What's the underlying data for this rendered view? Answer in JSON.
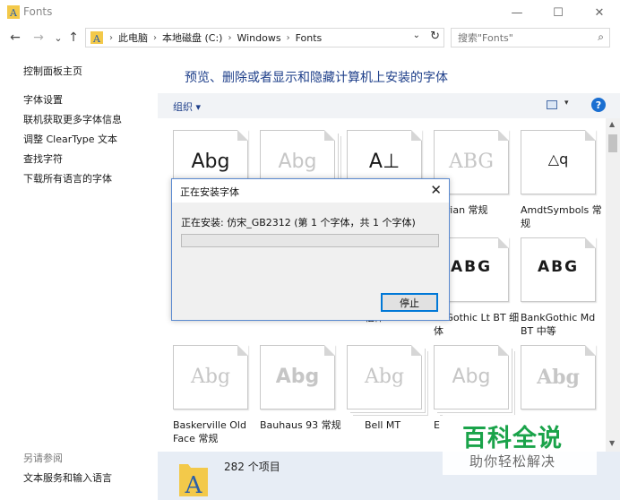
{
  "window": {
    "title": "Fonts",
    "controls": {
      "minimize": "—",
      "maximize": "☐",
      "close": "✕"
    }
  },
  "nav": {
    "back": "←",
    "forward": "→",
    "recent": "⌄",
    "up": "↑",
    "breadcrumb": [
      "此电脑",
      "本地磁盘 (C:)",
      "Windows",
      "Fonts"
    ],
    "separator": "›",
    "dropdown": "⌄",
    "refresh": "↻",
    "search_placeholder": "搜索\"Fonts\"",
    "search_icon": "⌕"
  },
  "sidebar": {
    "items": [
      {
        "label": "控制面板主页"
      },
      {
        "label": "字体设置"
      },
      {
        "label": "联机获取更多字体信息"
      },
      {
        "label": "调整 ClearType 文本"
      },
      {
        "label": "查找字符"
      },
      {
        "label": "下载所有语言的字体"
      }
    ],
    "see_also_title": "另请参阅",
    "see_also_items": [
      {
        "label": "文本服务和输入语言"
      }
    ]
  },
  "main": {
    "heading": "预览、删除或者显示和隐藏计算机上安装的字体",
    "toolbar": {
      "organize": "组织 ▾",
      "view_dropdown": "▾",
      "help": "?"
    },
    "fonts": [
      {
        "preview": "Abg",
        "label": "",
        "style": "dark",
        "stack": false
      },
      {
        "preview": "Abg",
        "label": "",
        "style": "faded",
        "stack": true
      },
      {
        "preview": "A⊥",
        "label": "",
        "style": "dark",
        "stack": false
      },
      {
        "preview": "ABG",
        "label": "gerian 常规",
        "style": "faded",
        "stack": false
      },
      {
        "preview": "△q",
        "label": "AmdtSymbols 常规",
        "style": "dark",
        "stack": false
      },
      {
        "preview": "",
        "label": "",
        "style": "dark",
        "stack": false
      },
      {
        "preview": "",
        "label": "",
        "style": "dark",
        "stack": false
      },
      {
        "preview": "",
        "label": "MT 粗体",
        "style": "dark",
        "stack": false
      },
      {
        "preview": "ABG",
        "label": "nkGothic Lt BT 细体",
        "style": "dark",
        "stack": false
      },
      {
        "preview": "ABG",
        "label": "BankGothic Md BT 中等",
        "style": "dark",
        "stack": false
      },
      {
        "preview": "Abg",
        "label": "Baskerville Old Face 常规",
        "style": "faded",
        "stack": false
      },
      {
        "preview": "Abg",
        "label": "Bauhaus 93 常规",
        "style": "faded",
        "stack": false
      },
      {
        "preview": "Abg",
        "label": "Bell MT",
        "style": "faded",
        "stack": true
      },
      {
        "preview": "Abg",
        "label": "E",
        "style": "faded",
        "stack": true
      },
      {
        "preview": "Abg",
        "label": "",
        "style": "faded",
        "stack": false
      }
    ],
    "status_count": "282 个项目"
  },
  "dialog": {
    "title": "正在安装字体",
    "close": "✕",
    "status": "正在安装: 仿宋_GB2312 (第 1 个字体，共 1 个字体)",
    "progress_fraction": 0,
    "stop_button": "停止"
  },
  "watermark": {
    "line1": "百科全说",
    "line2": "助你轻松解决"
  },
  "scrollbar": {
    "up": "▲",
    "down": "▼"
  },
  "colors": {
    "accent": "#1e3f8a",
    "progress": "#06b025",
    "help": "#1b6fd1",
    "watermark_green": "#1aa34a"
  }
}
